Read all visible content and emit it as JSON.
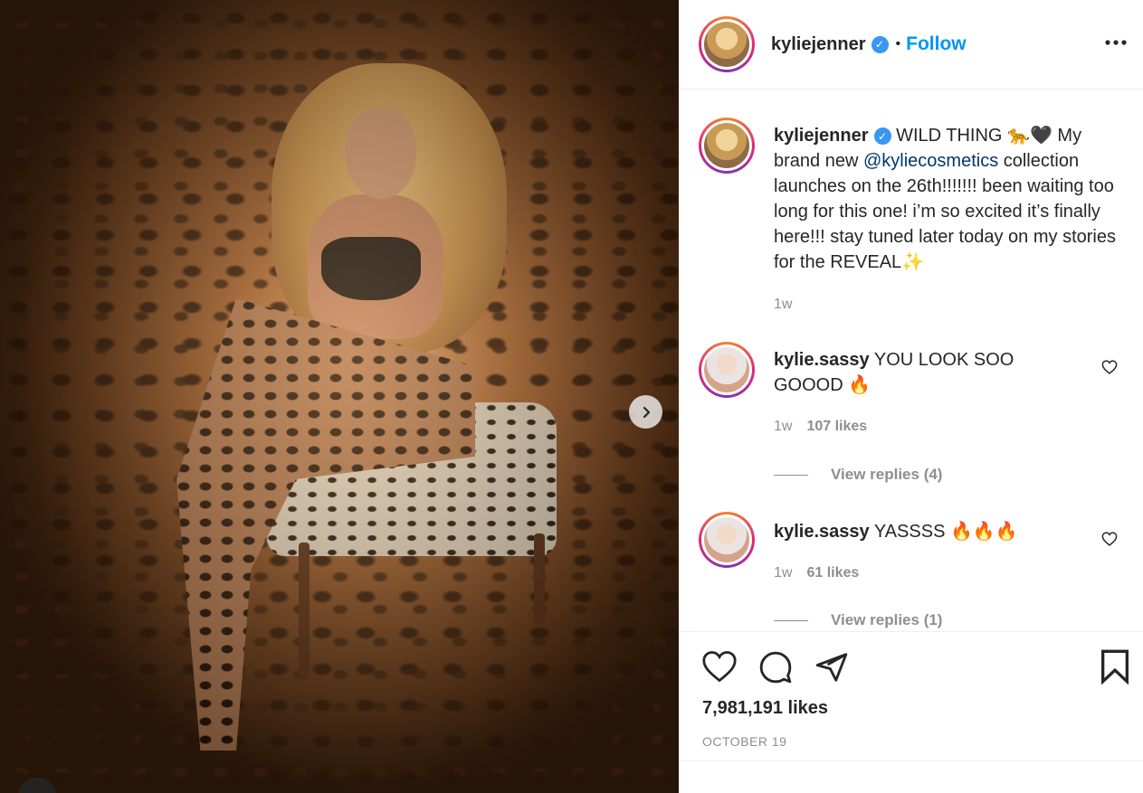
{
  "post": {
    "username": "kyliejenner",
    "follow_label": "Follow",
    "dot": "•",
    "more_label": "•••",
    "verified_mark": "✓"
  },
  "caption": {
    "username": "kyliejenner",
    "text_before_mention": " WILD THING 🐆🖤 My brand new ",
    "mention": "@kyliecosmetics",
    "text_after_mention": " collection launches on the 26th!!!!!!! been waiting too long for this one! i’m so excited it’s finally here!!! stay tuned later today on my stories for the REVEAL✨",
    "time": "1w"
  },
  "comments": [
    {
      "username": "kylie.sassy",
      "text": " YOU LOOK SOO GOOOD 🔥",
      "time": "1w",
      "likes": "107 likes",
      "replies": "View replies (4)"
    },
    {
      "username": "kylie.sassy",
      "text": " YASSSS 🔥🔥🔥",
      "time": "1w",
      "likes": "61 likes",
      "replies": "View replies (1)"
    }
  ],
  "stats": {
    "likes": "7,981,191 likes",
    "date": "OCTOBER 19"
  },
  "colors": {
    "link_blue": "#0095f6",
    "verified_blue": "#3897f0",
    "muted": "#8e8e8e"
  }
}
